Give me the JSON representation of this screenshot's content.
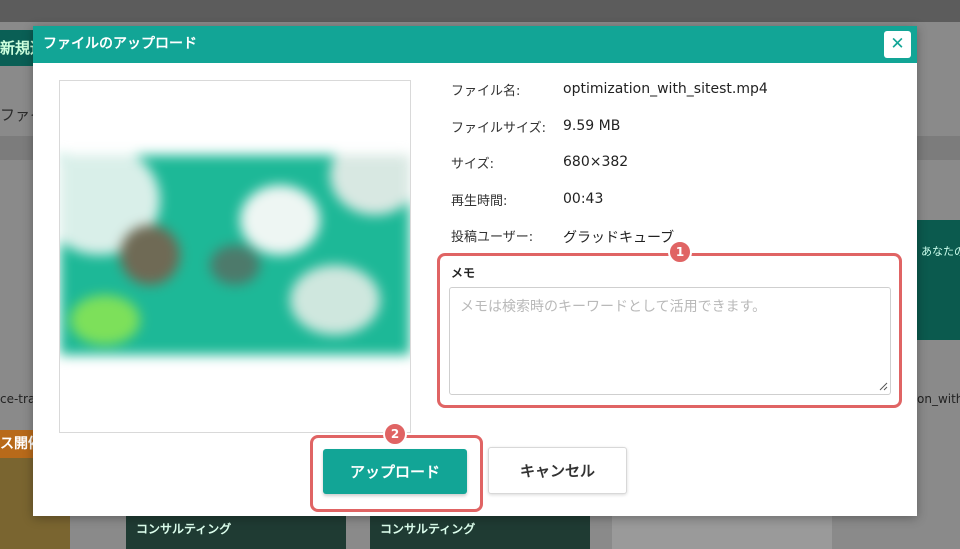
{
  "background": {
    "new_button": "新規追",
    "left_label": "ファイ",
    "right_card_text": "あなたの\n\"ちょ",
    "right_caption": "on_with",
    "left_caption": "ce-tran",
    "left_thumb_tag": "ス開催",
    "thumb_titles": [
      "コンサルティング",
      "コンサルティング",
      ""
    ]
  },
  "modal": {
    "title": "ファイルのアップロード",
    "close_symbol": "✕",
    "info": [
      {
        "label": "ファイル名:",
        "value": "optimization_with_sitest.mp4"
      },
      {
        "label": "ファイルサイズ:",
        "value": "9.59 MB"
      },
      {
        "label": "サイズ:",
        "value": "680×382"
      },
      {
        "label": "再生時間:",
        "value": "00:43"
      },
      {
        "label": "投稿ユーザー:",
        "value": "グラッドキューブ"
      }
    ],
    "memo": {
      "label": "メモ",
      "value": "",
      "placeholder": "メモは検索時のキーワードとして活用できます。"
    },
    "upload_label": "アップロード",
    "cancel_label": "キャンセル",
    "badges": [
      "1",
      "2"
    ]
  },
  "colors": {
    "accent": "#12a596",
    "highlight": "#e06464"
  }
}
